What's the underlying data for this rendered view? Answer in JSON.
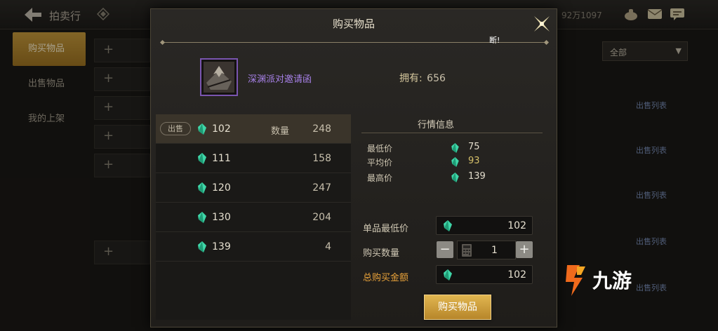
{
  "background": {
    "title": "拍卖行",
    "currency": "92万1097",
    "tabs": [
      "购买物品",
      "出售物品",
      "我的上架"
    ],
    "active_tab": 0,
    "filter": "全部",
    "list_link": "出售列表",
    "plus": "+"
  },
  "dialog": {
    "title": "购买物品",
    "note": "断!",
    "item": {
      "name": "深渊派对邀请函",
      "rarity_color": "#a680e6",
      "owned_label": "拥有:",
      "owned_value": "656"
    },
    "listing": {
      "sell_badge": "出售",
      "qty_header": "数量",
      "rows": [
        {
          "price": "102",
          "quantity": "248",
          "selected": true
        },
        {
          "price": "111",
          "quantity": "158"
        },
        {
          "price": "120",
          "quantity": "247"
        },
        {
          "price": "130",
          "quantity": "204"
        },
        {
          "price": "139",
          "quantity": "4"
        }
      ]
    },
    "market": {
      "title": "行情信息",
      "min_label": "最低价",
      "min_value": "75",
      "avg_label": "平均价",
      "avg_value": "93",
      "max_label": "最高价",
      "max_value": "139"
    },
    "purchase": {
      "unit_min_label": "单品最低价",
      "unit_min_value": "102",
      "qty_label": "购买数量",
      "qty_value": "1",
      "minus": "−",
      "plus": "+",
      "total_label": "总购买金额",
      "total_value": "102"
    },
    "buy_button": "购买物品"
  },
  "watermark": "九游",
  "icons": [
    "back-arrow-icon",
    "close-icon",
    "gem-icon",
    "calculator-icon",
    "mail-icon",
    "chat-icon",
    "bag-icon",
    "dropdown-arrow-icon"
  ],
  "colors": {
    "accent": "#c89b3c",
    "gem": "#3fd6a8",
    "total_label": "#e8a23a"
  }
}
